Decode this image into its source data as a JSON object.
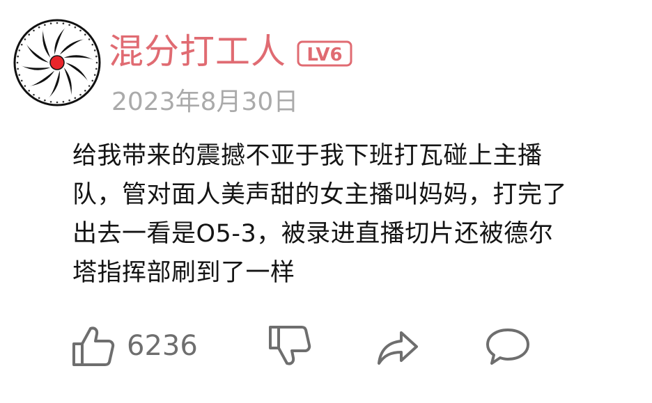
{
  "user": {
    "name": "混分打工人",
    "level_badge": "LV6",
    "avatar_icon": "spiral-wheel-avatar",
    "name_color": "#e06b72",
    "badge_color": "#e06b72"
  },
  "post": {
    "date": "2023年8月30日",
    "text_lines": [
      "给我带来的震撼不亚于我下班打瓦碰上主播",
      "队，管对面人美声甜的女主播叫妈妈，打完了",
      "出去一看是O5-3，被录进直播切片还被德尔",
      "塔指挥部刷到了一样"
    ]
  },
  "actions": {
    "like_icon": "thumbs-up-icon",
    "like_count": "6236",
    "dislike_icon": "thumbs-down-icon",
    "share_icon": "share-arrow-icon",
    "reply_icon": "comment-bubble-icon",
    "icon_color": "#6e6e6e"
  }
}
